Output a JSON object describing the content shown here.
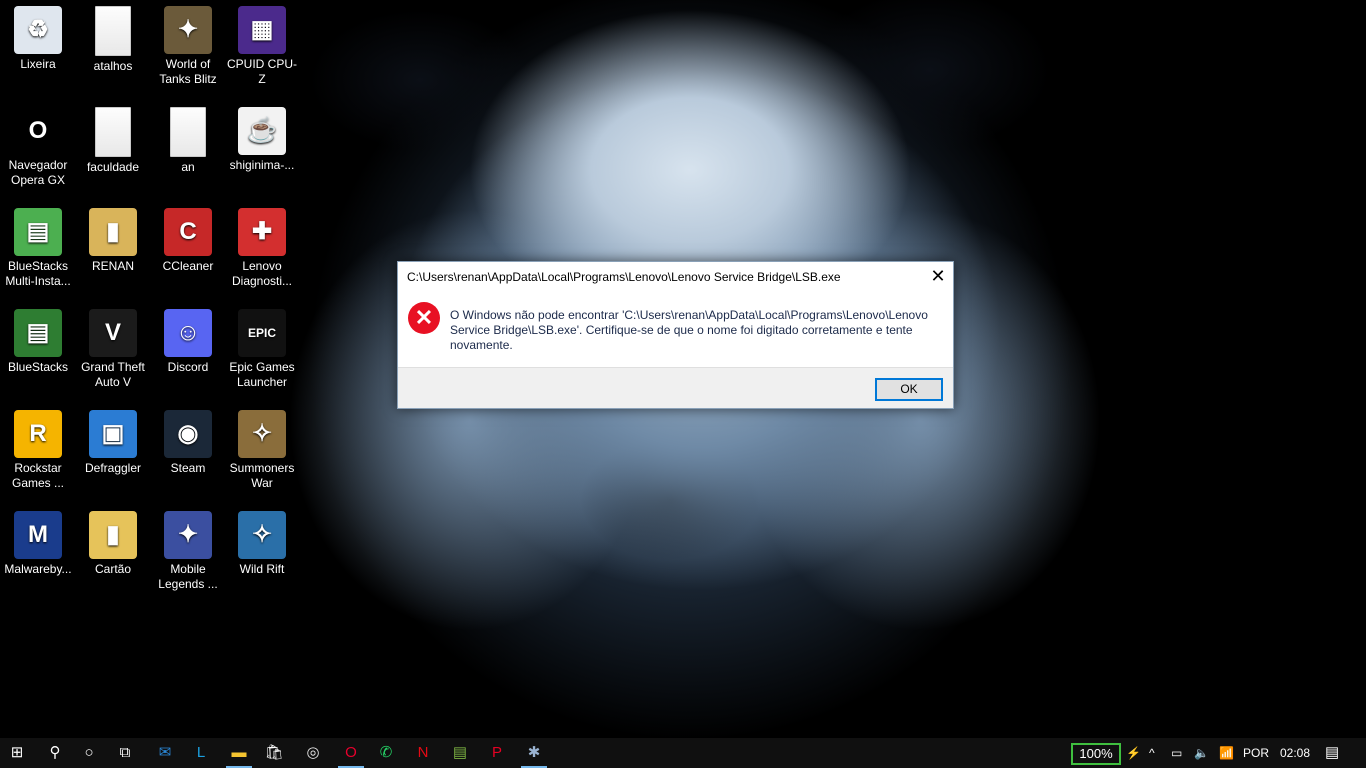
{
  "desktop": {
    "icons": [
      {
        "label": "Lixeira",
        "color": "#dfe6ee",
        "glyph": "♻"
      },
      {
        "label": "atalhos",
        "color": "#f3f3f3",
        "glyph": ""
      },
      {
        "label": "World of Tanks Blitz",
        "color": "#6b5a3a",
        "glyph": "✦"
      },
      {
        "label": "CPUID CPU-Z",
        "color": "#4b2a8c",
        "glyph": "▦"
      },
      {
        "label": "Navegador Opera GX",
        "color": "#000000",
        "glyph": "O"
      },
      {
        "label": "faculdade",
        "color": "#f3f3f3",
        "glyph": ""
      },
      {
        "label": "an",
        "color": "#f3f3f3",
        "glyph": ""
      },
      {
        "label": "shiginima-...",
        "color": "#f2f2f2",
        "glyph": "☕"
      },
      {
        "label": "BlueStacks Multi-Insta...",
        "color": "#4caf50",
        "glyph": "▤"
      },
      {
        "label": "RENAN",
        "color": "#d9b45a",
        "glyph": "▮"
      },
      {
        "label": "CCleaner",
        "color": "#c62828",
        "glyph": "C"
      },
      {
        "label": "Lenovo Diagnosti...",
        "color": "#d32f2f",
        "glyph": "✚"
      },
      {
        "label": "BlueStacks",
        "color": "#2e7d32",
        "glyph": "▤"
      },
      {
        "label": "Grand Theft Auto V",
        "color": "#1b1b1b",
        "glyph": "V"
      },
      {
        "label": "Discord",
        "color": "#5865f2",
        "glyph": "☺"
      },
      {
        "label": "Epic Games Launcher",
        "color": "#111111",
        "glyph": "EPIC"
      },
      {
        "label": "Rockstar Games ...",
        "color": "#f5b400",
        "glyph": "R"
      },
      {
        "label": "Defraggler",
        "color": "#2b7cd3",
        "glyph": "▣"
      },
      {
        "label": "Steam",
        "color": "#1b2838",
        "glyph": "◉"
      },
      {
        "label": "Summoners War",
        "color": "#8a6d3b",
        "glyph": "✧"
      },
      {
        "label": "Malwareby...",
        "color": "#1a3c8c",
        "glyph": "M"
      },
      {
        "label": "Cartão",
        "color": "#e6c35a",
        "glyph": "▮"
      },
      {
        "label": "Mobile Legends ...",
        "color": "#3b4fa0",
        "glyph": "✦"
      },
      {
        "label": "Wild Rift",
        "color": "#2a6fa8",
        "glyph": "✧"
      }
    ]
  },
  "dialog": {
    "title": "C:\\Users\\renan\\AppData\\Local\\Programs\\Lenovo\\Lenovo Service Bridge\\LSB.exe",
    "close_glyph": "✕",
    "error_glyph": "✕",
    "message": "O Windows não pode encontrar 'C:\\Users\\renan\\AppData\\Local\\Programs\\Lenovo\\Lenovo Service Bridge\\LSB.exe'. Certifique-se de que o nome foi digitado corretamente e tente novamente.",
    "ok_label": "OK"
  },
  "taskbar": {
    "start_glyph": "⊞",
    "search_glyph": "⚲",
    "cortana_glyph": "○",
    "taskview_glyph": "⧉",
    "pinned": [
      {
        "name": "mail",
        "glyph": "✉",
        "color": "#2b88d8"
      },
      {
        "name": "lenovo-vantage",
        "glyph": "L",
        "color": "#1ba1e2"
      },
      {
        "name": "file-explorer",
        "glyph": "▬",
        "color": "#f4c430"
      },
      {
        "name": "store",
        "glyph": "🛍",
        "color": "#ffffff"
      },
      {
        "name": "media",
        "glyph": "◎",
        "color": "#e6e6e6"
      },
      {
        "name": "opera-gx",
        "glyph": "O",
        "color": "#e8002d"
      },
      {
        "name": "whatsapp",
        "glyph": "✆",
        "color": "#25d366"
      },
      {
        "name": "netflix",
        "glyph": "N",
        "color": "#e50914"
      },
      {
        "name": "bluestacks",
        "glyph": "▤",
        "color": "#7cb342"
      },
      {
        "name": "pinterest",
        "glyph": "P",
        "color": "#e60023"
      },
      {
        "name": "error-app",
        "glyph": "✱",
        "color": "#9ab3d1"
      }
    ],
    "battery": "100%",
    "plug_glyph": "⚡",
    "chevron_glyph": "^",
    "battery_glyph": "▭",
    "volume_glyph": "🔈",
    "wifi_glyph": "📶",
    "language": "POR",
    "time": "02:08",
    "notifications_glyph": "▤"
  }
}
